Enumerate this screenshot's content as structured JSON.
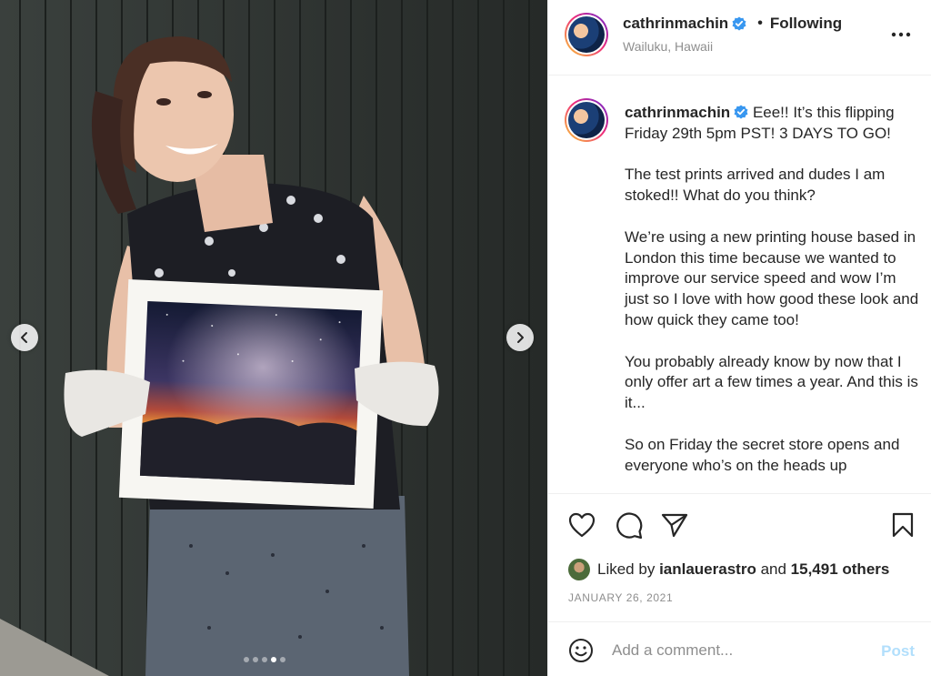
{
  "media": {
    "slide_index": 4,
    "slide_count": 5
  },
  "header": {
    "username": "cathrinmachin",
    "separator": "•",
    "follow_state": "Following",
    "location": "Wailuku, Hawaii"
  },
  "caption": {
    "username": "cathrinmachin",
    "paragraphs": [
      "Eee!! It’s this flipping Friday 29th 5pm PST! 3 DAYS TO GO!",
      "The test prints arrived and dudes I am stoked!! What do you think?",
      "We’re using a new printing house based in London this time because we wanted to improve our service speed and wow I’m just so I love with how good these look and how quick they came too!",
      "You probably already know by now that I only offer art a few times a year. And this is it...",
      "So on Friday the secret store opens and everyone who’s on the heads up"
    ]
  },
  "likes": {
    "prefix": "Liked by",
    "user": "ianlauerastro",
    "conjunction": "and",
    "others": "15,491 others"
  },
  "date": "JANUARY 26, 2021",
  "comment": {
    "placeholder": "Add a comment...",
    "post_label": "Post"
  },
  "colors": {
    "verified": "#3897f0",
    "post_disabled": "#b2dffc",
    "muted_text": "#8e8e8e"
  },
  "icons": [
    "chevron-left-icon",
    "chevron-right-icon",
    "more-icon",
    "heart-icon",
    "comment-icon",
    "share-icon",
    "bookmark-icon",
    "emoji-icon",
    "verified-icon"
  ]
}
